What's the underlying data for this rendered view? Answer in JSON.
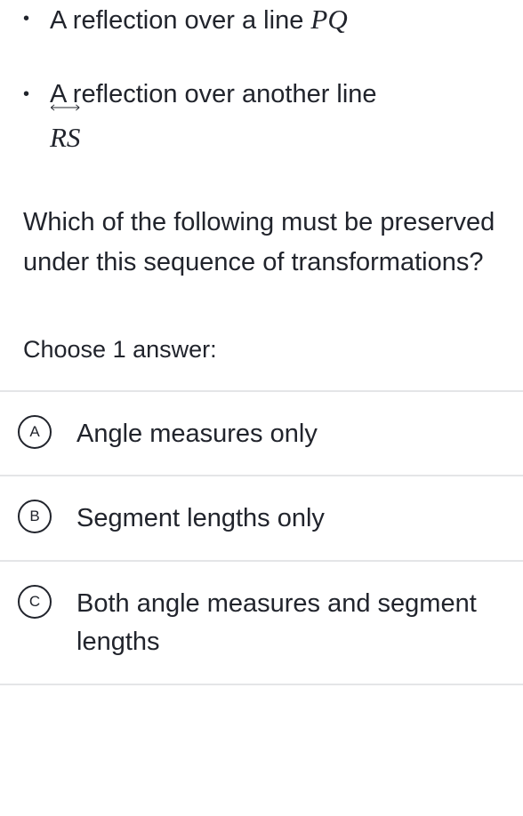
{
  "bullets": [
    {
      "prefix": "A reflection over a line ",
      "line_label": "PQ",
      "arrow_style": "pq"
    },
    {
      "prefix": "A reflection over another line ",
      "line_label": "RS",
      "arrow_style": "rs"
    }
  ],
  "question": "Which of the following must be preserved under this sequence of transformations?",
  "instruction": "Choose 1 answer:",
  "choices": [
    {
      "letter": "A",
      "text": "Angle measures only"
    },
    {
      "letter": "B",
      "text": "Segment lengths only"
    },
    {
      "letter": "C",
      "text": "Both angle measures and segment lengths"
    }
  ]
}
